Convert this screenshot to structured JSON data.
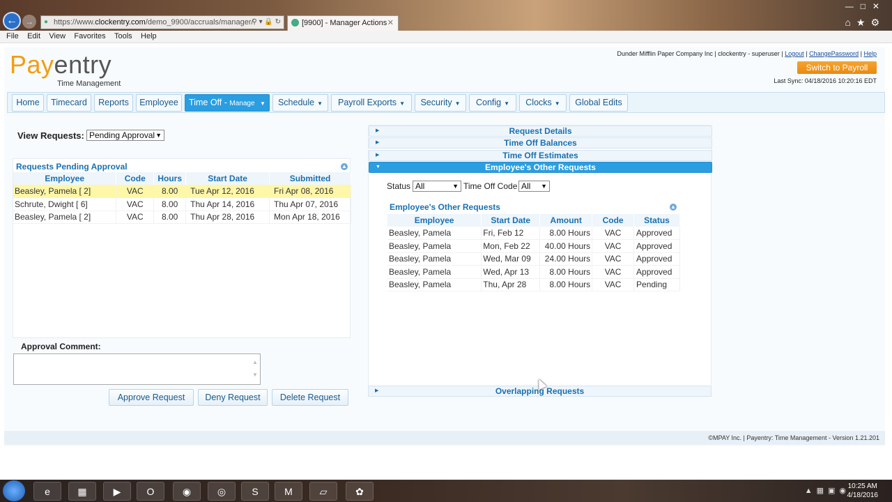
{
  "browser": {
    "url_prefix": "https://www.",
    "url_domain": "clockentry.com",
    "url_path": "/demo_9900/accruals/manager/",
    "tab_title": "[9900] - Manager Actions",
    "menu": [
      "File",
      "Edit",
      "View",
      "Favorites",
      "Tools",
      "Help"
    ]
  },
  "header": {
    "logo_pay": "Pay",
    "logo_entry": "entry",
    "logo_sub": "Time Management",
    "company_user": "Dunder Mifflin Paper Company Inc | clockentry - superuser |",
    "logout": "Logout",
    "change_password": "ChangePassword",
    "help": "Help",
    "sep": "|",
    "switch_label": "Switch to Payroll",
    "last_sync": "Last Sync: 04/18/2016 10:20:16 EDT"
  },
  "nav": {
    "home": "Home",
    "timecard": "Timecard",
    "reports": "Reports",
    "employee": "Employee",
    "timeoff": "Time Off -",
    "timeoff_small": "Manage",
    "schedule": "Schedule",
    "payroll_exports": "Payroll Exports",
    "security": "Security",
    "config": "Config",
    "clocks": "Clocks",
    "global_edits": "Global Edits"
  },
  "left": {
    "view_label": "View Requests:",
    "view_value": "Pending Approval",
    "panel_title": "Requests Pending Approval",
    "columns": [
      "Employee",
      "Code",
      "Hours",
      "Start Date",
      "Submitted"
    ],
    "rows": [
      [
        "Beasley, Pamela [ 2]",
        "VAC",
        "8.00",
        "Tue Apr 12, 2016",
        "Fri Apr 08, 2016"
      ],
      [
        "Schrute, Dwight [ 6]",
        "VAC",
        "8.00",
        "Thu Apr 14, 2016",
        "Thu Apr 07, 2016"
      ],
      [
        "Beasley, Pamela [ 2]",
        "VAC",
        "8.00",
        "Thu Apr 28, 2016",
        "Mon Apr 18, 2016"
      ]
    ],
    "comment_label": "Approval Comment:",
    "approve": "Approve Request",
    "deny": "Deny Request",
    "delete": "Delete Request"
  },
  "right": {
    "acc_details": "Request Details",
    "acc_balances": "Time Off Balances",
    "acc_estimates": "Time Off Estimates",
    "acc_other": "Employee's Other Requests",
    "status_label": "Status",
    "status_value": "All",
    "code_label": "Time Off Code",
    "code_value": "All",
    "inner_title": "Employee's Other Requests",
    "columns": [
      "Employee",
      "Start Date",
      "Amount",
      "Code",
      "Status"
    ],
    "rows": [
      [
        "Beasley, Pamela",
        "Fri, Feb 12",
        "8.00 Hours",
        "VAC",
        "Approved"
      ],
      [
        "Beasley, Pamela",
        "Mon, Feb 22",
        "40.00 Hours",
        "VAC",
        "Approved"
      ],
      [
        "Beasley, Pamela",
        "Wed, Mar 09",
        "24.00 Hours",
        "VAC",
        "Approved"
      ],
      [
        "Beasley, Pamela",
        "Wed, Apr 13",
        "8.00 Hours",
        "VAC",
        "Approved"
      ],
      [
        "Beasley, Pamela",
        "Thu, Apr 28",
        "8.00 Hours",
        "VAC",
        "Pending"
      ]
    ],
    "overlap": "Overlapping Requests"
  },
  "footer": "©MPAY Inc. | Payentry: Time Management - Version 1.21.201",
  "taskbar": {
    "time": "10:25 AM",
    "date": "4/18/2016"
  }
}
